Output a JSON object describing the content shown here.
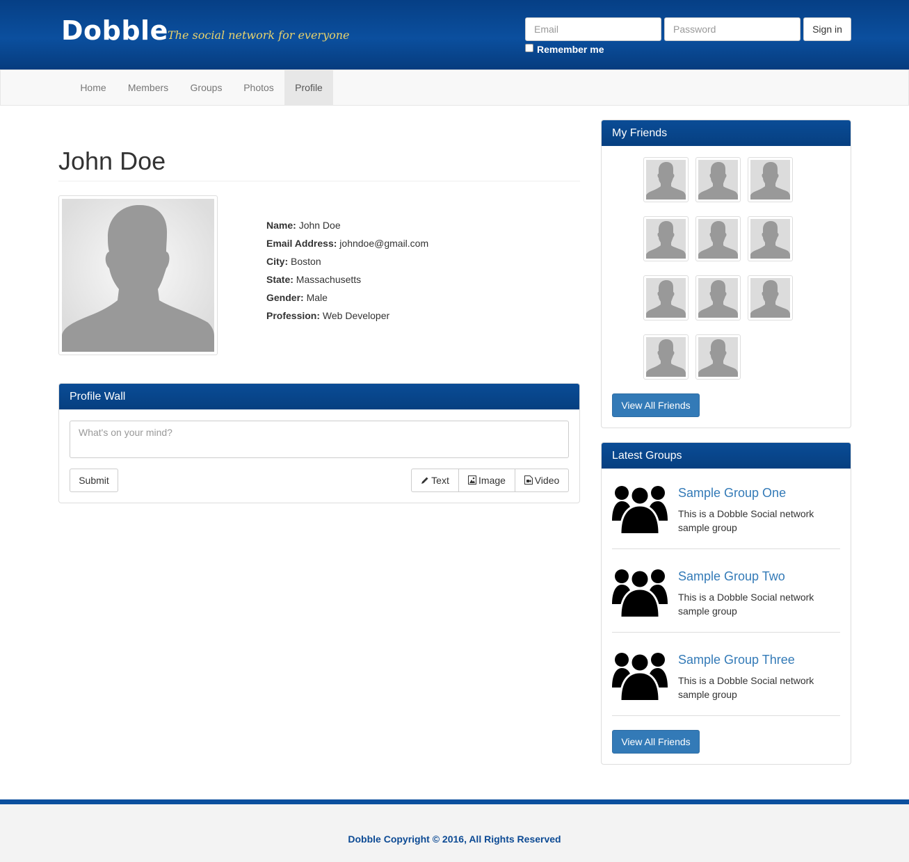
{
  "brand": {
    "logo": "Dobble",
    "tagline": "The social network for everyone"
  },
  "login": {
    "email_placeholder": "Email",
    "password_placeholder": "Password",
    "signin_label": "Sign in",
    "remember_label": "Remember me"
  },
  "nav": {
    "items": [
      {
        "label": "Home"
      },
      {
        "label": "Members"
      },
      {
        "label": "Groups"
      },
      {
        "label": "Photos"
      },
      {
        "label": "Profile",
        "active": true
      }
    ]
  },
  "profile": {
    "name": "John Doe",
    "fields": [
      {
        "label": "Name:",
        "value": "John Doe"
      },
      {
        "label": "Email Address:",
        "value": "johndoe@gmail.com"
      },
      {
        "label": "City:",
        "value": "Boston"
      },
      {
        "label": "State:",
        "value": "Massachusetts"
      },
      {
        "label": "Gender:",
        "value": "Male"
      },
      {
        "label": "Profession:",
        "value": "Web Developer"
      }
    ]
  },
  "wall": {
    "title": "Profile Wall",
    "placeholder": "What's on your mind?",
    "submit_label": "Submit",
    "type_buttons": [
      {
        "label": "Text",
        "icon": "pencil-icon"
      },
      {
        "label": "Image",
        "icon": "image-icon"
      },
      {
        "label": "Video",
        "icon": "video-file-icon"
      }
    ]
  },
  "friends": {
    "title": "My Friends",
    "count": 11,
    "button_label": "View All Friends"
  },
  "groups": {
    "title": "Latest Groups",
    "items": [
      {
        "name": "Sample Group One",
        "desc": "This is a Dobble Social network sample group"
      },
      {
        "name": "Sample Group Two",
        "desc": "This is a Dobble Social network sample group"
      },
      {
        "name": "Sample Group Three",
        "desc": "This is a Dobble Social network sample group"
      }
    ],
    "button_label": "View All Friends"
  },
  "footer": {
    "copyright": "Dobble Copyright © 2016, All Rights Reserved"
  },
  "colors": {
    "header_blue": "#0b4f9e",
    "link_blue": "#337ab7",
    "tagline_gold": "#e8d26c"
  }
}
